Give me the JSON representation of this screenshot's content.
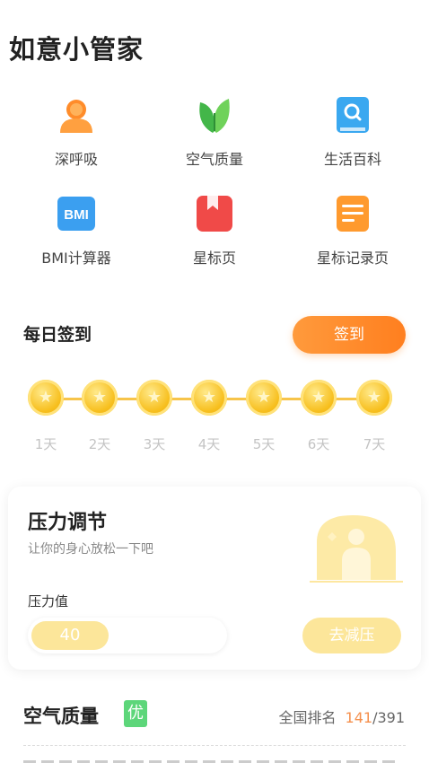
{
  "app": {
    "title": "如意小管家"
  },
  "tools": [
    {
      "label": "深呼吸",
      "icon": "person-orange-icon"
    },
    {
      "label": "空气质量",
      "icon": "green-leaves-icon"
    },
    {
      "label": "生活百科",
      "icon": "search-book-icon"
    },
    {
      "label": "BMI计算器",
      "icon": "bmi-icon"
    },
    {
      "label": "星标页",
      "icon": "bookmark-red-icon"
    },
    {
      "label": "星标记录页",
      "icon": "note-orange-icon"
    }
  ],
  "bmi_icon_text": "BMI",
  "checkin": {
    "title": "每日签到",
    "button": "签到",
    "days": [
      "1天",
      "2天",
      "3天",
      "4天",
      "5天",
      "6天",
      "7天"
    ]
  },
  "pressure": {
    "title": "压力调节",
    "subtitle": "让你的身心放松一下吧",
    "label": "压力值",
    "value": "40",
    "level_fraction": 0.4,
    "button": "去减压"
  },
  "air": {
    "title": "空气质量",
    "badge": "优",
    "rank_label": "全国排名",
    "rank_value": "141",
    "rank_total": "/391"
  },
  "colors": {
    "accent_orange": "#ff8a2a",
    "coin_gold": "#f7bf1e",
    "soft_yellow": "#fce69a",
    "good_green": "#5dd67a",
    "rank_orange": "#f5904d"
  }
}
